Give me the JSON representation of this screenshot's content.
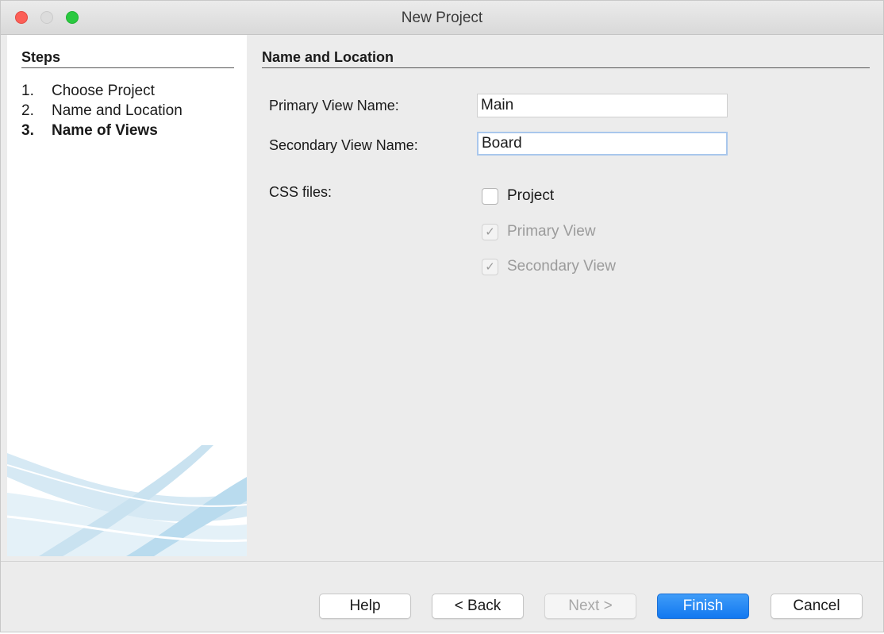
{
  "window": {
    "title": "New Project"
  },
  "steps": {
    "heading": "Steps",
    "items": [
      {
        "num": "1.",
        "label": "Choose Project",
        "current": false
      },
      {
        "num": "2.",
        "label": "Name and Location",
        "current": false
      },
      {
        "num": "3.",
        "label": "Name of Views",
        "current": true
      }
    ]
  },
  "panel": {
    "heading": "Name and Location",
    "primary_view": {
      "label": "Primary View Name:",
      "value": "Main"
    },
    "secondary_view": {
      "label": "Secondary View Name:",
      "value": "Board"
    },
    "css_files": {
      "label": "CSS files:",
      "options": [
        {
          "label": "Project",
          "checked": false,
          "enabled": true
        },
        {
          "label": "Primary View",
          "checked": true,
          "enabled": false
        },
        {
          "label": "Secondary View",
          "checked": true,
          "enabled": false
        }
      ]
    }
  },
  "buttons": {
    "help": "Help",
    "back": "< Back",
    "next": "Next >",
    "finish": "Finish",
    "cancel": "Cancel"
  },
  "colors": {
    "accent": "#1278f0",
    "focus_ring": "#a9c7ec",
    "close": "#fc5f57",
    "maximize": "#2ac940"
  }
}
